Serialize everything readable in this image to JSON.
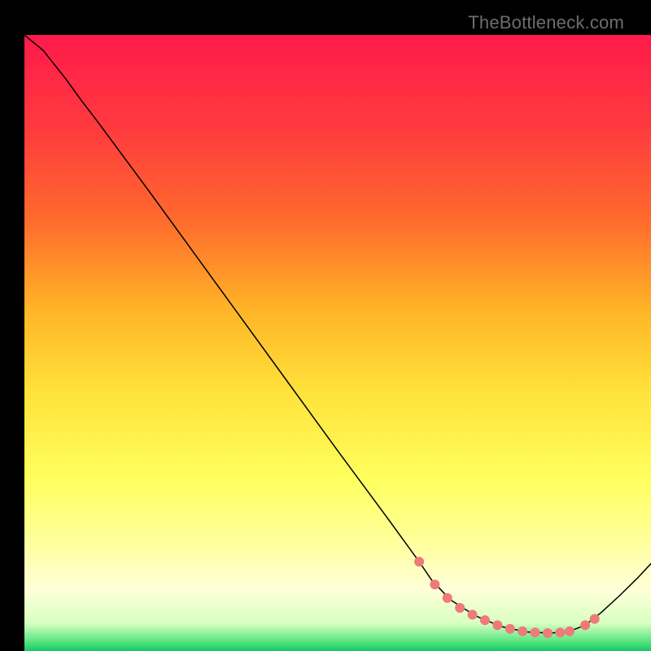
{
  "watermark": "TheBottleneck.com",
  "chart_data": {
    "type": "line",
    "title": "",
    "xlabel": "",
    "ylabel": "",
    "xlim": [
      0,
      100
    ],
    "ylim": [
      0,
      100
    ],
    "background_gradient": {
      "stops": [
        {
          "offset": 0.0,
          "color": "#ff1a4b"
        },
        {
          "offset": 0.15,
          "color": "#ff3a3e"
        },
        {
          "offset": 0.3,
          "color": "#ff6a2d"
        },
        {
          "offset": 0.45,
          "color": "#ffb627"
        },
        {
          "offset": 0.58,
          "color": "#ffe23b"
        },
        {
          "offset": 0.72,
          "color": "#ffff5e"
        },
        {
          "offset": 0.82,
          "color": "#ffff9a"
        },
        {
          "offset": 0.9,
          "color": "#ffffd8"
        },
        {
          "offset": 0.955,
          "color": "#d8ffc2"
        },
        {
          "offset": 0.985,
          "color": "#55e57e"
        },
        {
          "offset": 1.0,
          "color": "#18c76a"
        }
      ]
    },
    "series": [
      {
        "name": "bottleneck-curve",
        "stroke": "#000000",
        "stroke_width": 1.5,
        "x": [
          0.0,
          3.0,
          6.5,
          9.0,
          12.0,
          20.0,
          30.0,
          40.0,
          50.0,
          58.0,
          63.0,
          65.0,
          68.0,
          72.0,
          76.0,
          80.0,
          84.0,
          87.0,
          89.5,
          92.0,
          95.0,
          98.0,
          100.0
        ],
        "y": [
          100.0,
          97.5,
          93.0,
          89.5,
          85.5,
          74.5,
          60.5,
          46.5,
          32.5,
          21.5,
          14.5,
          11.5,
          8.3,
          5.7,
          4.0,
          3.1,
          2.9,
          3.2,
          4.2,
          6.2,
          9.0,
          12.0,
          14.2
        ]
      }
    ],
    "markers": {
      "name": "valley-markers",
      "color": "#ef7a7a",
      "radius_px": 6,
      "x": [
        63.0,
        65.5,
        67.5,
        69.5,
        71.5,
        73.5,
        75.5,
        77.5,
        79.5,
        81.5,
        83.5,
        85.5,
        87.0,
        89.5,
        91.0
      ],
      "y": [
        14.5,
        10.8,
        8.6,
        7.0,
        5.9,
        5.0,
        4.2,
        3.6,
        3.2,
        3.0,
        2.9,
        3.0,
        3.2,
        4.2,
        5.2
      ]
    }
  }
}
